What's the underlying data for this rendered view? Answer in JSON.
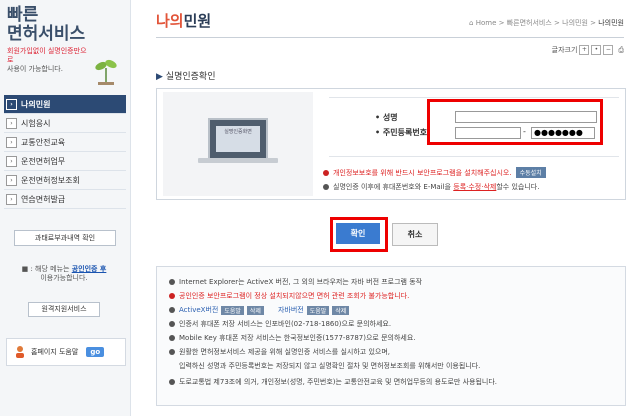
{
  "sidebar": {
    "brand_line1": "빠른",
    "brand_line2": "면허서비스",
    "note_red": "회원가입없이 실명인증만으로",
    "note_dark": "사용이 가능합니다.",
    "menu": [
      {
        "label": "나의민원",
        "active": true
      },
      {
        "label": "시험응시",
        "active": false
      },
      {
        "label": "교통안전교육",
        "active": false
      },
      {
        "label": "운전면허업무",
        "active": false
      },
      {
        "label": "운전면허정보조회",
        "active": false
      },
      {
        "label": "연습면허발급",
        "active": false
      }
    ],
    "fine_button": "과태료부과내역 확인",
    "cert_note_prefix": "■ : 해당 메뉴는",
    "cert_note_link": "공인인증 후",
    "cert_note_suffix": "이용가능합니다.",
    "remote_button": "원격지원서비스",
    "help_label": "홈페이지 도움말",
    "help_go": "go"
  },
  "header": {
    "title_highlight": "나의",
    "title_rest": "민원",
    "breadcrumb": [
      "Home",
      "빠른면허서비스",
      "나의민원",
      "나의민원"
    ],
    "font_size_label": "글자크기"
  },
  "auth": {
    "section_title": "실명인증확인",
    "illustration_label": "실명인증화면",
    "name_label": "성명",
    "rrn_label": "주민등록번호",
    "rrn_dash": "-",
    "rrn_mask": "●●●●●●●",
    "info1": "개인정보보호를 위해 반드시 보안프로그램을 설치해주십시오.",
    "info1_button": "수동설치",
    "info2_prefix": "실명인증 이후에 휴대폰번호와 E-Mail을",
    "info2_red": "등록·수정·삭제",
    "info2_suffix": "할수 있습니다."
  },
  "buttons": {
    "ok": "확인",
    "cancel": "취소"
  },
  "notice": {
    "lines": [
      "Internet Explorer는 ActiveX 버전, 그 외의 브라우저는 자바 버전 프로그램 동작",
      "공인인증 보안프로그램이 정상 설치되지않으면 면허 관련 조회가 불가능합니다.",
      "ActiveX버전",
      "인증서 휴대폰 저장 서비스는 인포바인(02-718-1860)으로 문의하세요.",
      "Mobile Key 휴대폰 저장 서비스는 한국정보인증(1577-8787)으로 문의하세요.",
      "원활한 면허정보서비스 제공을 위해 실명인증 서비스를 실시하고 있으며,",
      "입력하신 성명과 주민등록번호는 저장되지 않고 실명확인 절차 및 면허정보조회를 위해서만 이용됩니다.",
      "도로교통법 제73조에 의거, 개인정보(성명, 주민번호)는 교통안전교육 및 면허업무등의 용도로만 사용됩니다."
    ],
    "help_btn": "도움말",
    "delete_btn": "삭제",
    "java_label": "자바버전"
  }
}
